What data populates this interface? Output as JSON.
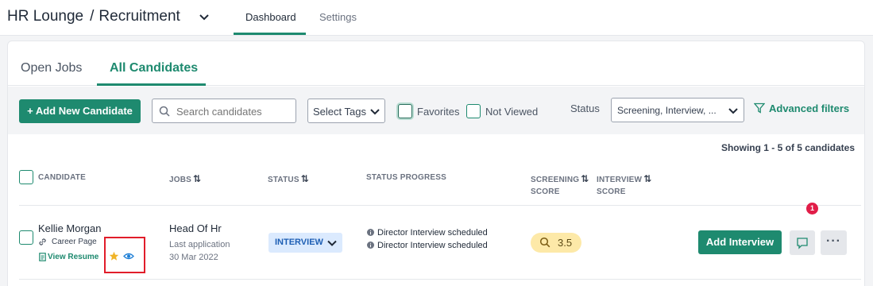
{
  "topbar": {
    "app_name": "HR Lounge",
    "separator": "/",
    "section": "Recruitment",
    "tabs": [
      {
        "label": "Dashboard",
        "active": true
      },
      {
        "label": "Settings",
        "active": false
      }
    ]
  },
  "subtabs": [
    {
      "label": "Open Jobs",
      "active": false
    },
    {
      "label": "All Candidates",
      "active": true
    }
  ],
  "filters": {
    "add_button": "+ Add New Candidate",
    "search_placeholder": "Search candidates",
    "select_tags": "Select Tags",
    "favorites_label": "Favorites",
    "not_viewed_label": "Not Viewed",
    "status_label": "Status",
    "status_value": "Screening, Interview, ...",
    "advanced_filters": "Advanced filters"
  },
  "table": {
    "showing": "Showing 1 - 5 of 5 candidates",
    "headers": {
      "candidate": "CANDIDATE",
      "jobs": "JOBS",
      "status": "STATUS",
      "status_progress": "STATUS PROGRESS",
      "screening_line1": "SCREENING",
      "screening_line2": "SCORE",
      "interview_line1": "INTERVIEW",
      "interview_line2": "SCORE"
    },
    "rows": [
      {
        "name": "Kellie Morgan",
        "source": "Career Page",
        "view_resume": "View Resume",
        "job_title": "Head Of Hr",
        "last_application_label": "Last application",
        "last_application_date": "30 Mar 2022",
        "status": "INTERVIEW",
        "progress": [
          "Director Interview scheduled",
          "Director Interview scheduled"
        ],
        "screening_score": "3.5",
        "action_button": "Add Interview",
        "comment_count": "1"
      }
    ]
  },
  "colors": {
    "accent": "#1e8a6f",
    "status_pill_bg": "#dbeafe",
    "score_pill_bg": "#fde9a8",
    "badge": "#e11d48",
    "highlight": "#e11d2a"
  },
  "icons": [
    "chevron-down-icon",
    "search-icon",
    "filter-icon",
    "link-icon",
    "document-icon",
    "star-icon",
    "eye-icon",
    "info-icon",
    "magnifier-icon",
    "comment-icon",
    "more-icon",
    "sort-icon"
  ]
}
